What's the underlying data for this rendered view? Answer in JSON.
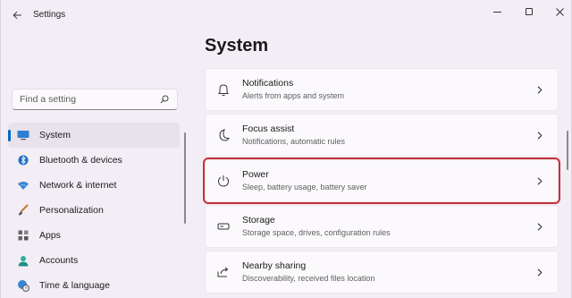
{
  "window": {
    "title": "Settings"
  },
  "search": {
    "placeholder": "Find a setting"
  },
  "sidebar": {
    "items": [
      {
        "label": "System",
        "icon": "system-monitor-icon",
        "active": true
      },
      {
        "label": "Bluetooth & devices",
        "icon": "bluetooth-icon"
      },
      {
        "label": "Network & internet",
        "icon": "wifi-icon"
      },
      {
        "label": "Personalization",
        "icon": "brush-icon"
      },
      {
        "label": "Apps",
        "icon": "apps-grid-icon"
      },
      {
        "label": "Accounts",
        "icon": "account-icon"
      },
      {
        "label": "Time & language",
        "icon": "globe-clock-icon"
      }
    ]
  },
  "main": {
    "title": "System",
    "cards": [
      {
        "title": "Notifications",
        "subtitle": "Alerts from apps and system",
        "icon": "bell-icon"
      },
      {
        "title": "Focus assist",
        "subtitle": "Notifications, automatic rules",
        "icon": "moon-icon"
      },
      {
        "title": "Power",
        "subtitle": "Sleep, battery usage, battery saver",
        "icon": "power-icon",
        "highlighted": true
      },
      {
        "title": "Storage",
        "subtitle": "Storage space, drives, configuration rules",
        "icon": "storage-drive-icon"
      },
      {
        "title": "Nearby sharing",
        "subtitle": "Discoverability, received files location",
        "icon": "share-icon"
      }
    ]
  },
  "colors": {
    "accent": "#0067c0",
    "highlight": "#c6303a",
    "background": "#f3eef5"
  }
}
